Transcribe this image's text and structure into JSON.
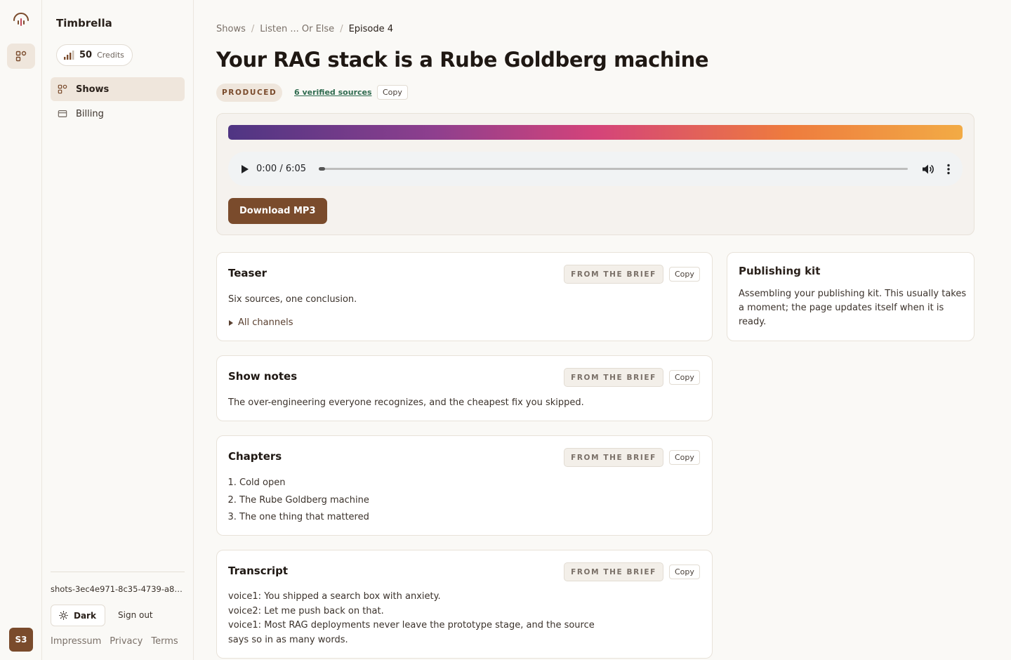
{
  "sidebar": {
    "brand": "Timbrella",
    "credits_value": "50",
    "credits_label": "Credits",
    "nav": [
      {
        "label": "Shows",
        "icon": "grid-icon",
        "active": true
      },
      {
        "label": "Billing",
        "icon": "card-icon",
        "active": false
      }
    ],
    "session_id": "shots-3ec4e971-8c35-4739-a8d4-...",
    "theme_label": "Dark",
    "signout_label": "Sign out",
    "footer_links": [
      "Impressum",
      "Privacy",
      "Terms"
    ]
  },
  "rail": {
    "avatar_initials": "S3"
  },
  "breadcrumb": [
    "Shows",
    "Listen ... Or Else",
    "Episode 4"
  ],
  "episode": {
    "title": "Your RAG stack is a Rube Goldberg machine",
    "status": "PRODUCED",
    "sources_link": "6 verified sources",
    "copy_label": "Copy"
  },
  "player": {
    "time": "0:00 / 6:05",
    "progress": 0,
    "download_label": "Download MP3"
  },
  "cards": {
    "tag_label": "FROM THE BRIEF",
    "copy_label": "Copy",
    "teaser": {
      "title": "Teaser",
      "text": "Six sources, one conclusion.",
      "details_label": "All channels"
    },
    "show_notes": {
      "title": "Show notes",
      "text": "The over-engineering everyone recognizes, and the cheapest fix you skipped."
    },
    "chapters": {
      "title": "Chapters",
      "items": [
        "Cold open",
        "The Rube Goldberg machine",
        "The one thing that mattered"
      ]
    },
    "transcript": {
      "title": "Transcript",
      "lines": [
        "voice1: You shipped a search box with anxiety.",
        "voice2: Let me push back on that.",
        "voice1: Most RAG deployments never leave the prototype stage, and the source",
        "says so in as many words."
      ]
    }
  },
  "kit": {
    "title": "Publishing kit",
    "text": "Assembling your publishing kit. This usually takes a moment; the page updates itself when it is ready."
  },
  "colors": {
    "accent": "#7a4b2c",
    "link": "#2f6b4f"
  }
}
